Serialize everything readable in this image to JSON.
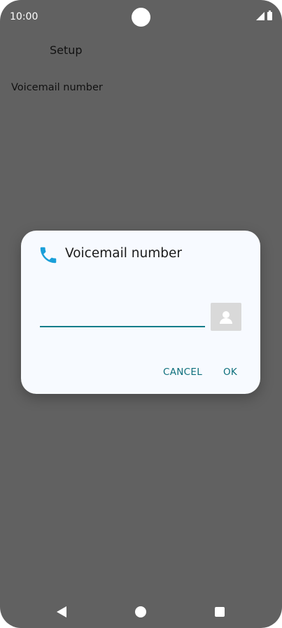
{
  "status_bar": {
    "time": "10:00",
    "icons": [
      "signal-icon",
      "battery-icon"
    ]
  },
  "screen": {
    "title": "Setup",
    "setting_item": "Voicemail number"
  },
  "dialog": {
    "title": "Voicemail number",
    "icon": "phone-icon",
    "input_value": "",
    "contact_picker_icon": "contact-icon",
    "cancel_label": "CANCEL",
    "ok_label": "OK",
    "accent_color": "#0e7d8a",
    "icon_color": "#1a9fd9"
  },
  "nav_bar": {
    "icons": [
      "back-icon",
      "home-icon",
      "recents-icon"
    ]
  }
}
